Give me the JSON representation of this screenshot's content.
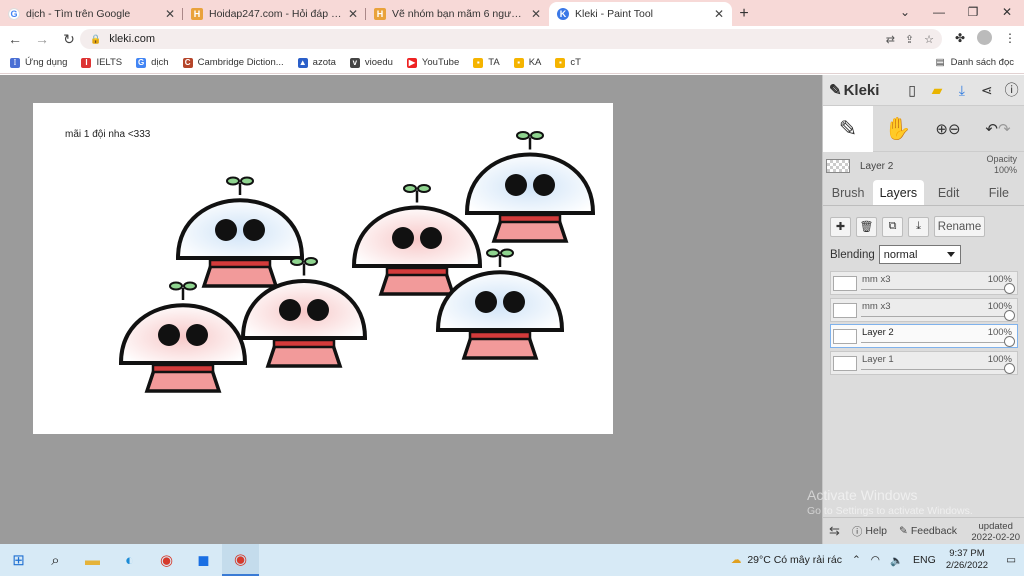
{
  "browser": {
    "tabs": [
      {
        "title": "dịch - Tìm trên Google",
        "icon": "google-icon",
        "active": false
      },
      {
        "title": "Hoidap247.com - Hỏi đáp online",
        "icon": "hoidap-icon",
        "active": false
      },
      {
        "title": "Vẽ nhóm bạn mãm 6 người câu hỏi",
        "icon": "hoidap-icon",
        "active": false
      },
      {
        "title": "Kleki - Paint Tool",
        "icon": "kleki-icon",
        "active": true
      }
    ],
    "url": "kleki.com",
    "bookmarks": [
      {
        "label": "Ứng dụng",
        "icon": "apps-grid-icon",
        "color": "#4a6fd4"
      },
      {
        "label": "IELTS",
        "icon": "ielts-icon",
        "color": "#d33"
      },
      {
        "label": "dịch",
        "icon": "google-icon",
        "color": "#4285f4"
      },
      {
        "label": "Cambridge Diction...",
        "icon": "cambridge-icon",
        "color": "#b5452a"
      },
      {
        "label": "azota",
        "icon": "azota-icon",
        "color": "#2b5fc9"
      },
      {
        "label": "vioedu",
        "icon": "vioedu-icon",
        "color": "#444"
      },
      {
        "label": "YouTube",
        "icon": "youtube-icon",
        "color": "#e22"
      },
      {
        "label": "TA",
        "icon": "classroom-icon",
        "color": "#f5b400"
      },
      {
        "label": "KA",
        "icon": "classroom-icon",
        "color": "#f5b400"
      },
      {
        "label": "cT",
        "icon": "classroom-icon",
        "color": "#f5b400"
      }
    ],
    "reading_list": "Danh sách đọc"
  },
  "canvas": {
    "note": "mãi 1 đội nha <333"
  },
  "kleki": {
    "logo": "Kleki",
    "current_layer": "Layer 2",
    "opacity_label": "Opacity",
    "opacity_value": "100%",
    "tabs": [
      "Brush",
      "Layers",
      "Edit",
      "File"
    ],
    "active_tab": "Layers",
    "rename_label": "Rename",
    "blending_label": "Blending",
    "blending_value": "normal",
    "layers": [
      {
        "name": "mm x3",
        "opacity": "100%",
        "selected": false
      },
      {
        "name": "mm x3",
        "opacity": "100%",
        "selected": false
      },
      {
        "name": "Layer 2",
        "opacity": "100%",
        "selected": true
      },
      {
        "name": "Layer 1",
        "opacity": "100%",
        "selected": false
      }
    ],
    "footer": {
      "help": "Help",
      "feedback": "Feedback",
      "updated_label": "updated",
      "updated_date": "2022-02-20"
    }
  },
  "watermark": {
    "line1": "Activate Windows",
    "line2": "Go to Settings to activate Windows."
  },
  "taskbar": {
    "weather": "29°C  Có mây rải rác",
    "language": "ENG",
    "time": "9:37 PM",
    "date": "2/26/2022"
  }
}
